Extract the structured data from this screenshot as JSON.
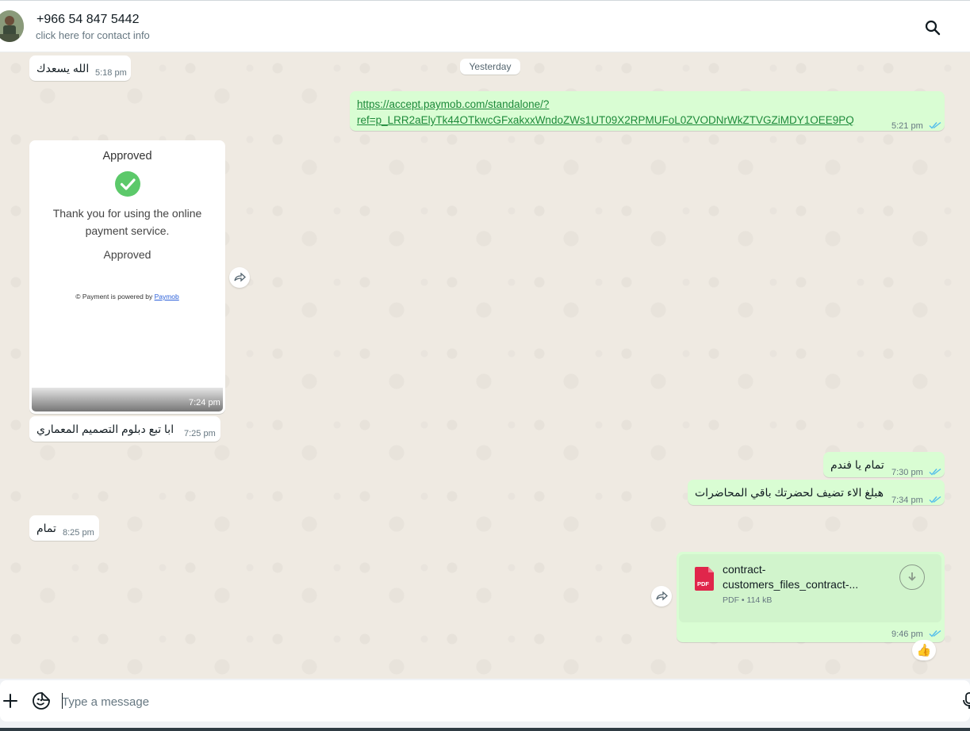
{
  "header": {
    "contact_name": "+966 54 847 5442",
    "contact_subtitle": "click here for contact info"
  },
  "chat": {
    "date_separator": "Yesterday",
    "messages": [
      {
        "direction": "in",
        "text": "الله يسعدك",
        "time": "5:18 pm"
      },
      {
        "direction": "out",
        "link_line1": "https://accept.paymob.com/standalone/?",
        "link_line2": "ref=p_LRR2aElyTk44OTkwcGFxakxxWndoZWs1UT09X2RPMUFoL0ZVODNrWkZTVGZiMDY1OEE9PQ",
        "time": "5:21 pm"
      },
      {
        "direction": "in",
        "type": "image",
        "image_title": "Approved",
        "image_text": "Thank you for using the online payment service.",
        "image_status": "Approved",
        "image_footer": "© Payment is powered by",
        "image_footer_link": "Paymob",
        "time": "7:24 pm"
      },
      {
        "direction": "in",
        "text": "ابا تبع دبلوم التصميم المعماري",
        "time": "7:25 pm"
      },
      {
        "direction": "out",
        "text": "تمام يا فندم",
        "time": "7:30 pm"
      },
      {
        "direction": "out",
        "text": "هبلغ الاء تضيف لحضرتك باقي المحاضرات",
        "time": "7:34 pm"
      },
      {
        "direction": "in",
        "text": "تمام",
        "time": "8:25 pm"
      },
      {
        "direction": "out",
        "type": "document",
        "doc_name_line1": "contract-",
        "doc_name_line2": "customers_files_contract-...",
        "doc_type": "PDF",
        "doc_meta": "PDF • 114 kB",
        "time": "9:46 pm",
        "reaction": "👍"
      }
    ]
  },
  "composer": {
    "placeholder": "Type a message"
  },
  "colors": {
    "outgoing_bubble": "#d9fdd3",
    "incoming_bubble": "#ffffff",
    "read_ticks": "#53bdeb",
    "chat_background": "#efeae2"
  }
}
